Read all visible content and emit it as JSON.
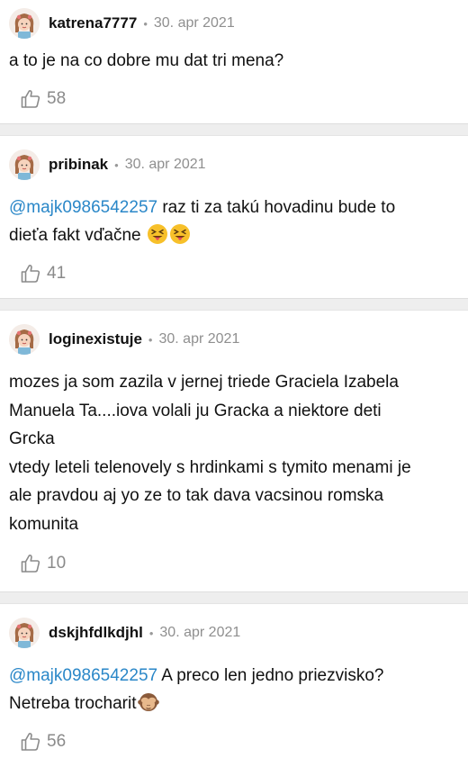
{
  "comments": [
    {
      "username": "katrena7777",
      "date": "30. apr 2021",
      "text_lines": [
        "a to je na co dobre mu dat tri mena?"
      ],
      "likes": "58"
    },
    {
      "username": "pribinak",
      "date": "30. apr 2021",
      "mention": "@majk0986542257",
      "text_line1": " raz ti za takú hovadinu bude to",
      "text_line2": "dieťa fakt vďačne",
      "emojis": [
        "face-with-tongue-squinting",
        "face-with-tongue-squinting"
      ],
      "likes": "41"
    },
    {
      "username": "loginexistuje",
      "date": "30. apr 2021",
      "text_lines": [
        "mozes ja som zazila v jernej triede Graciela Izabela",
        "Manuela Ta....iova volali ju Gracka a niektore deti",
        "Grcka",
        "vtedy leteli telenovely s hrdinkami s tymito menami je",
        "ale pravdou aj yo ze to tak dava vacsinou romska",
        "komunita"
      ],
      "likes": "10"
    },
    {
      "username": "dskjhfdlkdjhl",
      "date": "30. apr 2021",
      "mention": "@majk0986542257",
      "text_line1": " A preco len jedno priezvisko?",
      "text_line2": "Netreba trocharit",
      "emojis": [
        "see-no-evil-monkey"
      ],
      "likes": "56"
    }
  ],
  "colors": {
    "mention": "#2a87c8",
    "muted": "#8f8f8f",
    "separator": "#eeeeee"
  },
  "icons": [
    "avatar-girl-icon",
    "thumbs-up-icon"
  ]
}
